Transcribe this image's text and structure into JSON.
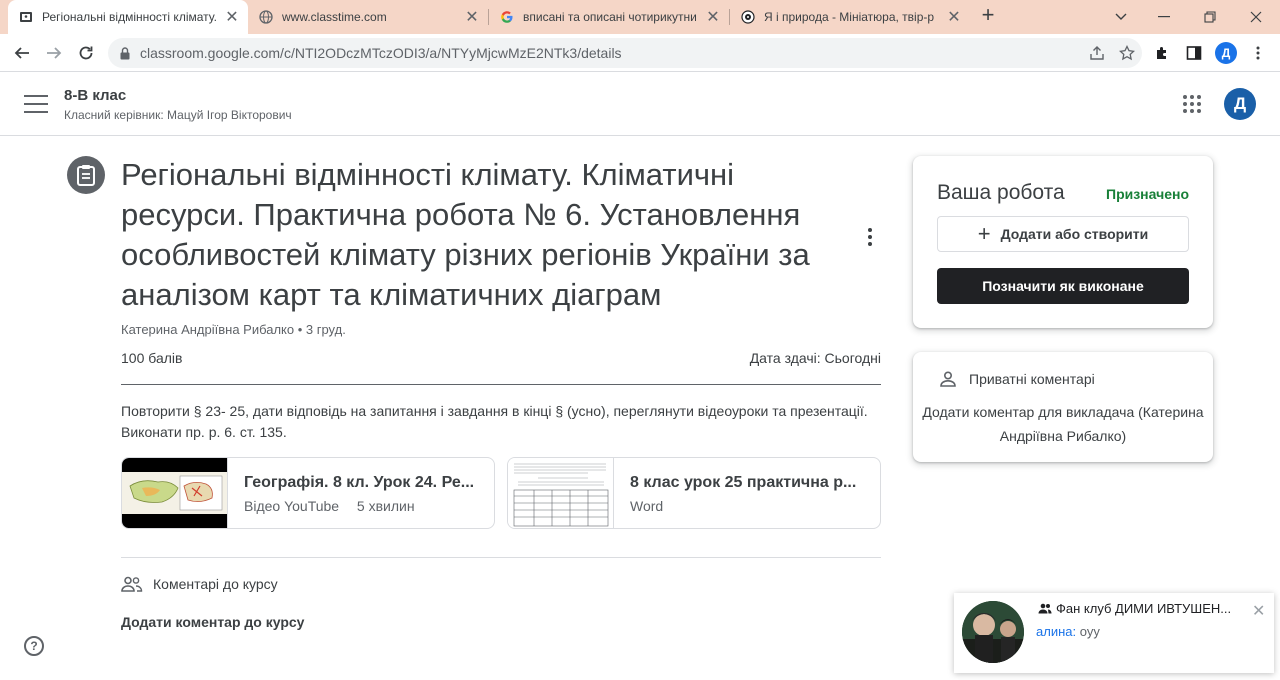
{
  "browser": {
    "tabs": [
      {
        "title": "Регіональні відмінності клімату.",
        "icon": "classroom-icon",
        "active": true
      },
      {
        "title": "www.classtime.com",
        "icon": "globe-icon",
        "active": false
      },
      {
        "title": "вписані та описані чотирикутни",
        "icon": "google-icon",
        "active": false
      },
      {
        "title": "Я і природа - Мініатюра, твір-р",
        "icon": "eye-logo-icon",
        "active": false
      }
    ],
    "new_tab": "+",
    "url": "classroom.google.com/c/NTI2ODczMTczODI3/a/NTYyMjcwMzE2NTk3/details",
    "profile_initial": "Д"
  },
  "header": {
    "class_name": "8-В клас",
    "class_teacher": "Класний керівник: Мацуй Ігор Вікторович",
    "avatar_initial": "Д"
  },
  "assignment": {
    "title": "Регіональні відмінності клімату. Кліматичні ресурси. Практична робота № 6. Установлення особливостей клімату різних регіонів України за аналізом карт та кліматичних діаграм",
    "author": "Катерина Андріївна Рибалко • 3 груд.",
    "points": "100 балів",
    "due": "Дата здачі: Сьогодні",
    "description": "Повторити § 23- 25, дати відповідь на запитання і завдання в кінці § (усно), переглянути відеоуроки та презентації. Виконати пр. р. 6. ст. 135.",
    "attachments": [
      {
        "title": "Географія. 8 кл. Урок 24. Ре...",
        "type": "Відео YouTube",
        "duration": "5 хвилин"
      },
      {
        "title": "8 клас урок 25 практична р...",
        "type": "Word",
        "duration": ""
      }
    ]
  },
  "class_comments": {
    "heading": "Коментарі до курсу",
    "add_label": "Додати коментар до курсу"
  },
  "your_work": {
    "title": "Ваша робота",
    "status": "Призначено",
    "add_label": "Додати або створити",
    "done_label": "Позначити як виконане"
  },
  "private_comments": {
    "heading": "Приватні коментарі",
    "add_label": "Додати коментар для викладача (Катерина Андріївна Рибалко)"
  },
  "notification": {
    "title": "Фан клуб ДИМИ ИВТУШЕН...",
    "sender": "алина:",
    "message": "оуу"
  },
  "help_label": "?"
}
